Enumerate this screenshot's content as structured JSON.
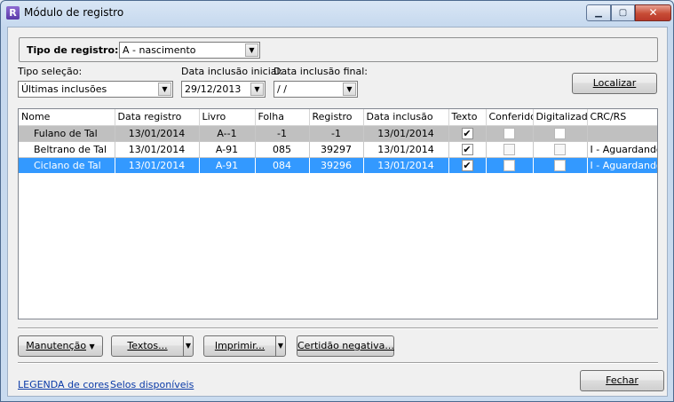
{
  "window": {
    "title": "Módulo de registro",
    "app_icon_letter": "R"
  },
  "filters": {
    "tipo_registro_label": "Tipo de registro:",
    "tipo_registro_value": "A - nascimento",
    "tipo_selecao_label": "Tipo seleção:",
    "tipo_selecao_value": "Últimas inclusões",
    "data_inicial_label": "Data inclusão inicial:",
    "data_inicial_value": "29/12/2013",
    "data_final_label": "Data inclusão final:",
    "data_final_value": " /  /",
    "localizar_label": "Localizar"
  },
  "grid": {
    "columns": [
      "Nome",
      "Data registro",
      "Livro",
      "Folha",
      "Registro",
      "Data inclusão",
      "Texto",
      "Conferido",
      "Digitalizado",
      "CRC/RS"
    ],
    "rows": [
      {
        "nome": "Fulano de Tal",
        "data_registro": "13/01/2014",
        "livro": "A--1",
        "folha": "-1",
        "registro": "-1",
        "data_inclusao": "13/01/2014",
        "texto": "✔",
        "conferido": "",
        "digitalizado": "",
        "crc": ""
      },
      {
        "nome": "Beltrano de Tal",
        "data_registro": "13/01/2014",
        "livro": "A-91",
        "folha": "085",
        "registro": "39297",
        "data_inclusao": "13/01/2014",
        "texto": "✔",
        "conferido": "",
        "digitalizado": "",
        "crc": "I - Aguardando"
      },
      {
        "nome": "Ciclano de Tal",
        "data_registro": "13/01/2014",
        "livro": "A-91",
        "folha": "084",
        "registro": "39296",
        "data_inclusao": "13/01/2014",
        "texto": "✔",
        "conferido": "",
        "digitalizado": "",
        "crc": "I - Aguardando"
      }
    ]
  },
  "actions": {
    "manutencao": "Manutenção",
    "textos": "Textos...",
    "imprimir": "Imprimir...",
    "certidao": "Certidão negativa..."
  },
  "footer": {
    "legenda": "LEGENDA de cores",
    "selos": "Selos disponíveis",
    "fechar": "Fechar"
  }
}
